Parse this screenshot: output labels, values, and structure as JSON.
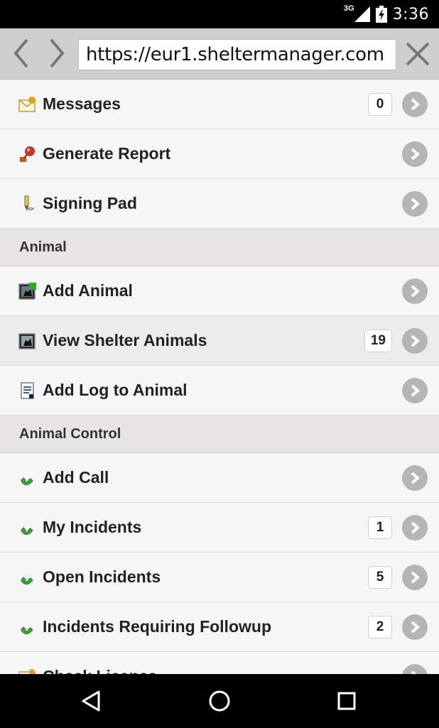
{
  "status_bar": {
    "network_type": "3G",
    "time": "3:36",
    "icons": [
      "signal-icon",
      "battery-charging-icon"
    ]
  },
  "browser": {
    "url": "https://eur1.sheltermanager.com",
    "back_icon": "chevron-left-icon",
    "forward_icon": "chevron-right-icon",
    "close_icon": "close-icon"
  },
  "menu": {
    "top_items": [
      {
        "label": "Messages",
        "count": "0",
        "icon": "envelope-icon"
      },
      {
        "label": "Generate Report",
        "count": null,
        "icon": "report-icon"
      },
      {
        "label": "Signing Pad",
        "count": null,
        "icon": "pen-icon"
      }
    ],
    "sections": [
      {
        "title": "Animal",
        "items": [
          {
            "label": "Add Animal",
            "count": null,
            "icon": "animal-add-icon"
          },
          {
            "label": "View Shelter Animals",
            "count": "19",
            "icon": "animal-icon"
          },
          {
            "label": "Add Log to Animal",
            "count": null,
            "icon": "log-icon"
          }
        ]
      },
      {
        "title": "Animal Control",
        "items": [
          {
            "label": "Add Call",
            "count": null,
            "icon": "phone-icon"
          },
          {
            "label": "My Incidents",
            "count": "1",
            "icon": "phone-icon"
          },
          {
            "label": "Open Incidents",
            "count": "5",
            "icon": "phone-icon"
          },
          {
            "label": "Incidents Requiring Followup",
            "count": "2",
            "icon": "phone-icon"
          },
          {
            "label": "Check Licence",
            "count": null,
            "icon": "licence-icon"
          }
        ]
      }
    ]
  },
  "nav_bar": {
    "icons": [
      "back-triangle-icon",
      "home-circle-icon",
      "recents-square-icon"
    ]
  },
  "colors": {
    "row_bg": "#f6f6f6",
    "divider_bg": "#e8e4e6",
    "chevron_bg": "#b5b5b5",
    "toolbar_bg": "#cfcfcf"
  }
}
